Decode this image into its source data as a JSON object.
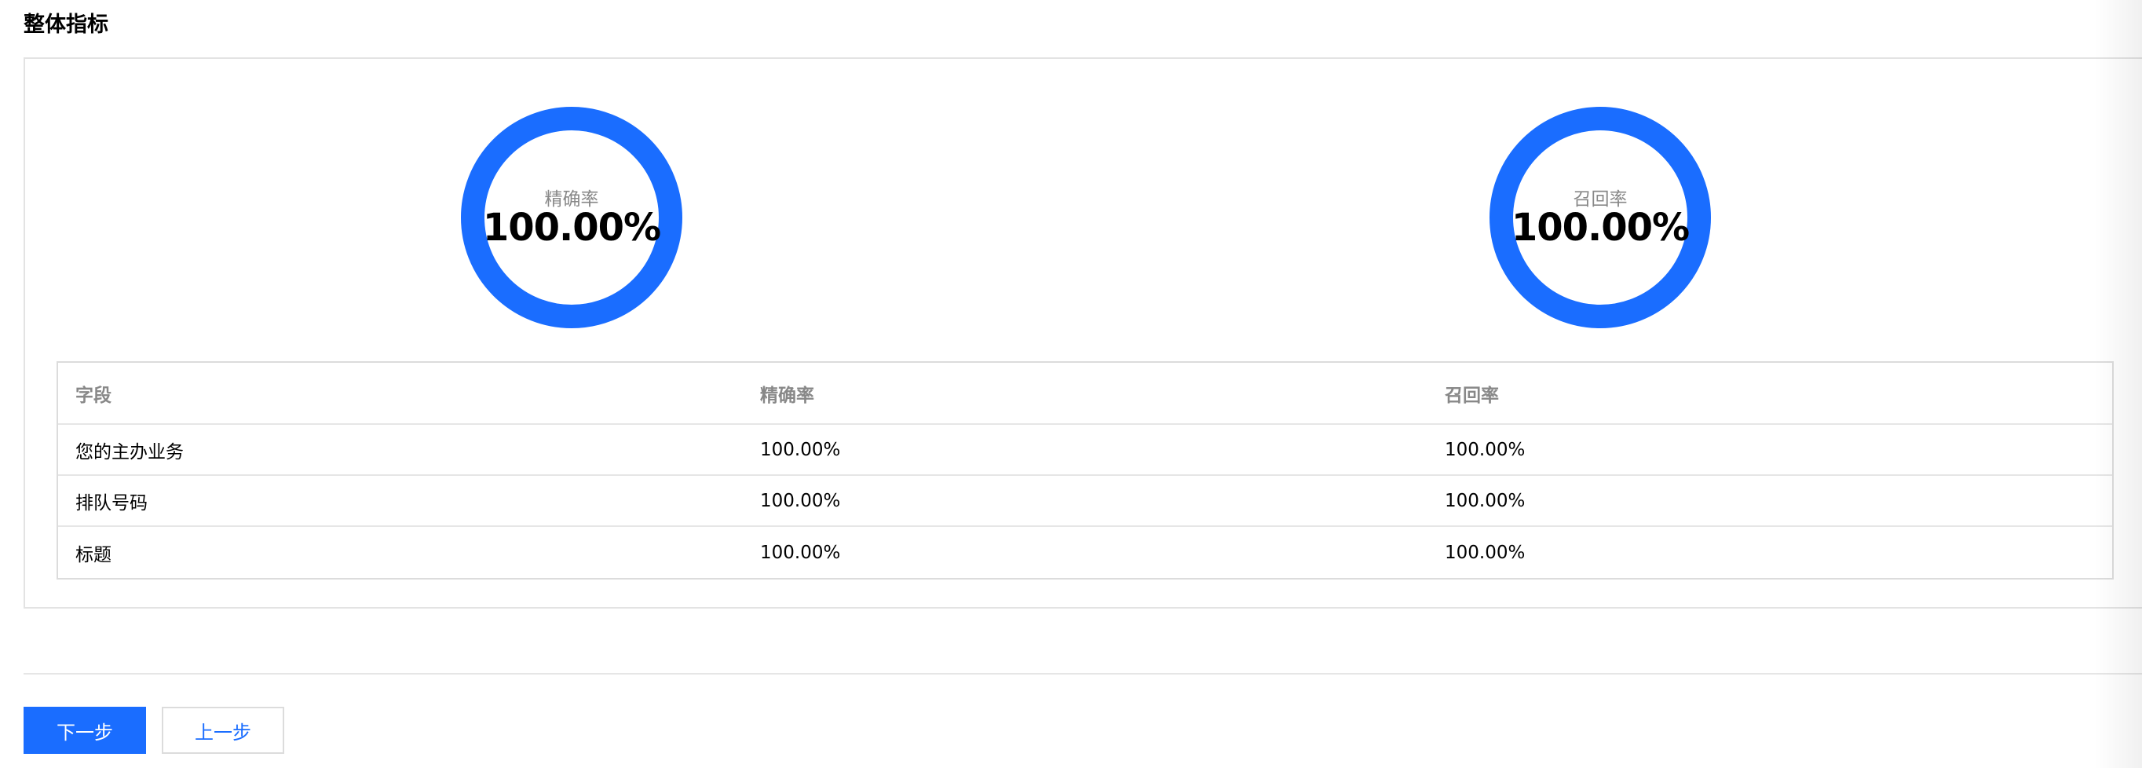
{
  "section": {
    "title": "整体指标"
  },
  "rings": [
    {
      "label": "精确率",
      "value_text": "100.00%",
      "fraction": 1.0,
      "color": "#1a6dff"
    },
    {
      "label": "召回率",
      "value_text": "100.00%",
      "fraction": 1.0,
      "color": "#1a6dff"
    }
  ],
  "table": {
    "headers": [
      "字段",
      "精确率",
      "召回率"
    ],
    "rows": [
      [
        "您的主办业务",
        "100.00%",
        "100.00%"
      ],
      [
        "排队号码",
        "100.00%",
        "100.00%"
      ],
      [
        "标题",
        "100.00%",
        "100.00%"
      ]
    ]
  },
  "actions": {
    "next_label": "下一步",
    "prev_label": "上一步"
  },
  "colors": {
    "accent": "#1a6dff",
    "border": "#e3e3e3",
    "muted_text": "#888888"
  }
}
